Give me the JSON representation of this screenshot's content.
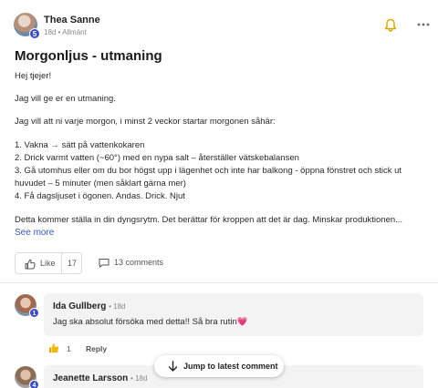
{
  "post": {
    "author": "Thea Sanne",
    "level": "5",
    "meta": "18d • Allmänt",
    "title": "Morgonljus - utmaning",
    "paragraphs": [
      "Hej tjejer!",
      "Jag vill ge er en utmaning.",
      "Jag vill att ni varje morgon, i minst 2 veckor startar morgonen såhär:",
      "1. Vakna → sätt på vattenkokaren",
      "2. Drick varmt vatten (~60°) med en nypa salt – återställer vätskebalansen",
      "3. Gå utomhus eller om du bor högst upp i lägenhet och inte har balkong - öppna fönstret och stick ut",
      "huvudet – 5 minuter (men såklart gärna mer)",
      "4. Få dagsljuset i ögonen. Andas. Drick. Njut",
      "Detta kommer ställa in din dyngsrytm. Det berättar för kroppen att det är dag. Minskar produktionen..."
    ],
    "see_more": "See more",
    "like_label": "Like",
    "like_count": "17",
    "comments_label": "13 comments"
  },
  "comments": [
    {
      "author": "Ida Gullberg",
      "time": "18d",
      "level": "1",
      "text": "Jag ska absolut försöka med detta!! Så bra rutin",
      "emoji": "💗",
      "like_count": "1",
      "reply_label": "Reply"
    },
    {
      "author": "Jeanette Larsson",
      "time": "18d",
      "level": "4"
    }
  ],
  "jump_label": "Jump to latest comment",
  "icons": {
    "bell": "bell-icon",
    "more": "more-horizontal-icon",
    "like": "thumbs-up-icon",
    "comment": "comment-icon",
    "arrow": "arrow-down-icon"
  },
  "colors": {
    "accent": "#3555c4",
    "badge": "#3b4fc4",
    "bell": "#e0a800"
  }
}
